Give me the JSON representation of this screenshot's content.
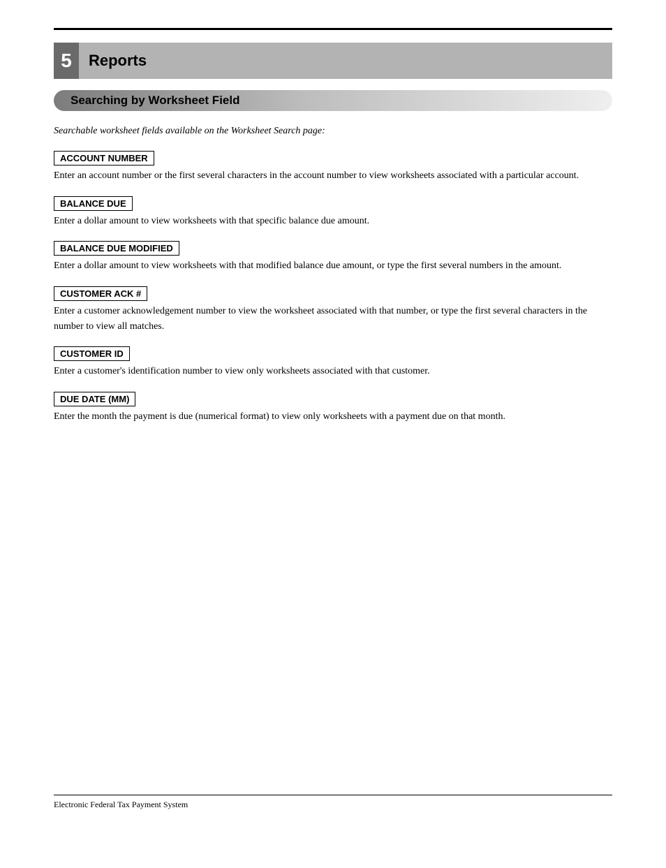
{
  "chapter": {
    "number": "5",
    "title": "Reports"
  },
  "section": {
    "title": "Searching by Worksheet Field"
  },
  "intro": "Searchable worksheet fields available on the Worksheet Search page:",
  "fields": [
    {
      "label": "ACCOUNT NUMBER",
      "desc": "Enter an account number or the first several characters in the account number to view worksheets associated with a particular account."
    },
    {
      "label": "BALANCE DUE",
      "desc": "Enter a dollar amount to view worksheets with that specific balance due amount."
    },
    {
      "label": "BALANCE DUE MODIFIED",
      "desc": "Enter a dollar amount to view worksheets with that modified balance due amount, or type the first several numbers in the amount."
    },
    {
      "label": "CUSTOMER ACK #",
      "desc": "Enter a customer acknowledgement number to view the worksheet associated with that number, or type the first several characters in the number to view all matches."
    },
    {
      "label": "CUSTOMER ID",
      "desc": "Enter a customer's identification number to view only worksheets associated with that customer."
    },
    {
      "label": "DUE DATE (MM)",
      "desc": "Enter the month the payment is due (numerical format) to view only worksheets with a payment due on that month."
    }
  ],
  "footer": "Electronic Federal Tax Payment System"
}
